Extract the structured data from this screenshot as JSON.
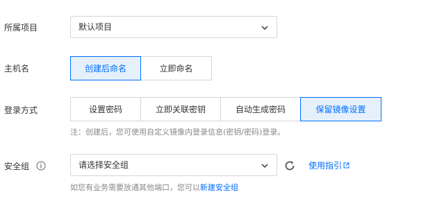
{
  "project": {
    "label": "所属项目",
    "value": "默认项目"
  },
  "hostname": {
    "label": "主机名",
    "options": [
      "创建后命名",
      "立即命名"
    ],
    "selected": 0
  },
  "login": {
    "label": "登录方式",
    "options": [
      "设置密码",
      "立即关联密钥",
      "自动生成密码",
      "保留镜像设置"
    ],
    "selected": 3,
    "note": "注：创建后，您可使用自定义镜像内登录信息(密钥/密码)登录。"
  },
  "security_group": {
    "label": "安全组",
    "placeholder": "请选择安全组",
    "guide_link": "使用指引",
    "note_prefix": "如您有业务需要放通其他端口，您可以",
    "note_link": "新建安全组"
  },
  "colors": {
    "accent": "#006eff",
    "active_bg": "#e6f0fb",
    "border": "#d5d5d5",
    "muted": "#888888"
  }
}
